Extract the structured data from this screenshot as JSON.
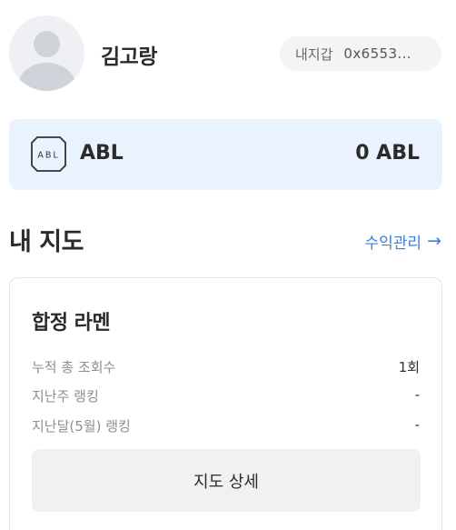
{
  "profile": {
    "name": "김고랑",
    "wallet_label": "내지갑",
    "wallet_address": "0x6553..."
  },
  "token": {
    "icon_text": "ABL",
    "name": "ABL",
    "balance": "0 ABL"
  },
  "my_maps": {
    "title": "내 지도",
    "link_label": "수익관리",
    "link_arrow": "→"
  },
  "map_card": {
    "title": "합정 라멘",
    "stats": [
      {
        "label": "누적 총 조회수",
        "value": "1회"
      },
      {
        "label": "지난주 랭킹",
        "value": "-"
      },
      {
        "label": "지난달(5월) 랭킹",
        "value": "-"
      }
    ],
    "detail_button": "지도 상세"
  },
  "colors": {
    "accent": "#3b7de0",
    "token_card_bg": "#eaf3fd",
    "button_bg": "#f0f1f3"
  }
}
